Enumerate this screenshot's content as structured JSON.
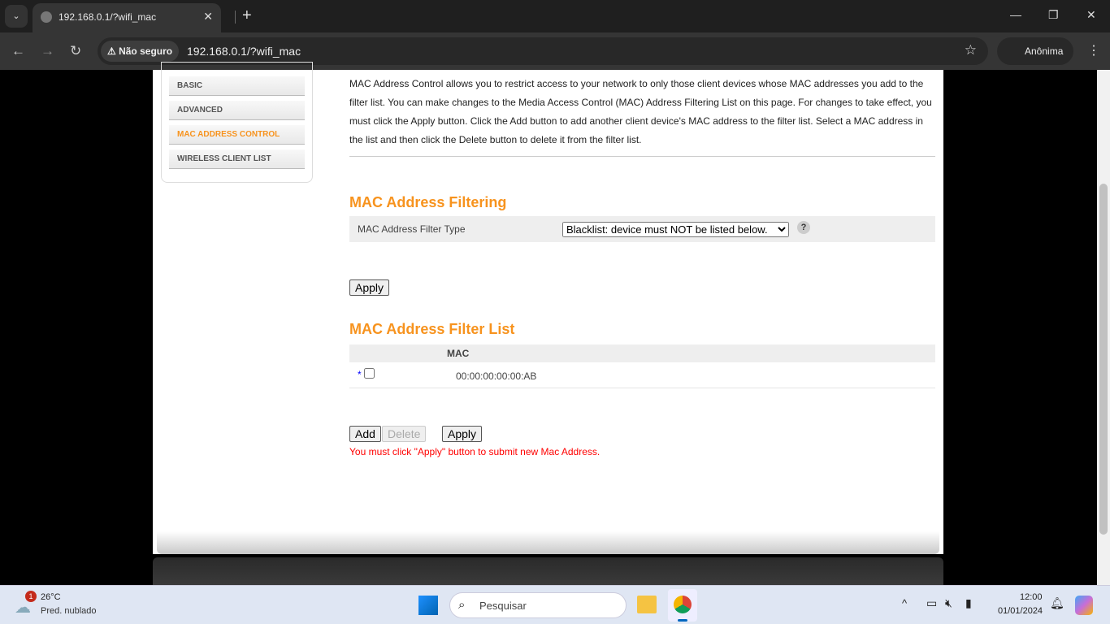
{
  "browser": {
    "tab_title": "192.168.0.1/?wifi_mac",
    "security": "Não seguro",
    "url": "192.168.0.1/?wifi_mac",
    "profile": "Anônima"
  },
  "sidebar": {
    "items": [
      {
        "label": "BASIC"
      },
      {
        "label": "ADVANCED"
      },
      {
        "label": "MAC ADDRESS CONTROL",
        "active": true
      },
      {
        "label": "WIRELESS CLIENT LIST"
      }
    ]
  },
  "main": {
    "description": "MAC Address Control allows you to restrict access to your network to only those client devices whose MAC addresses you add to the filter list. You can make changes to the Media Access Control (MAC) Address Filtering List on this page. For changes to take effect, you must click the Apply button. Click the Add button to add another client device's MAC address to the filter list. Select a MAC address in the list and then click the Delete button to delete it from the filter list.",
    "filtering_title": "MAC Address Filtering",
    "filter_type_label": "MAC Address Filter Type",
    "filter_type_value": "Blacklist: device must NOT be listed below.",
    "help": "?",
    "apply_label": "Apply",
    "list_title": "MAC Address Filter List",
    "list_header": "MAC",
    "rows": [
      {
        "marker": "*",
        "mac": "00:00:00:00:00:AB",
        "checked": false
      }
    ],
    "add_label": "Add",
    "delete_label": "Delete",
    "apply2_label": "Apply",
    "notice": "You must click \"Apply\" button to submit new Mac Address.",
    "accent_color": "#f7931e",
    "notice_color": "#ff0000"
  },
  "taskbar": {
    "weather_temp": "26°C",
    "weather_desc": "Pred. nublado",
    "weather_badge": "1",
    "search_placeholder": "Pesquisar",
    "time": "12:00",
    "date": "01/01/2024"
  }
}
